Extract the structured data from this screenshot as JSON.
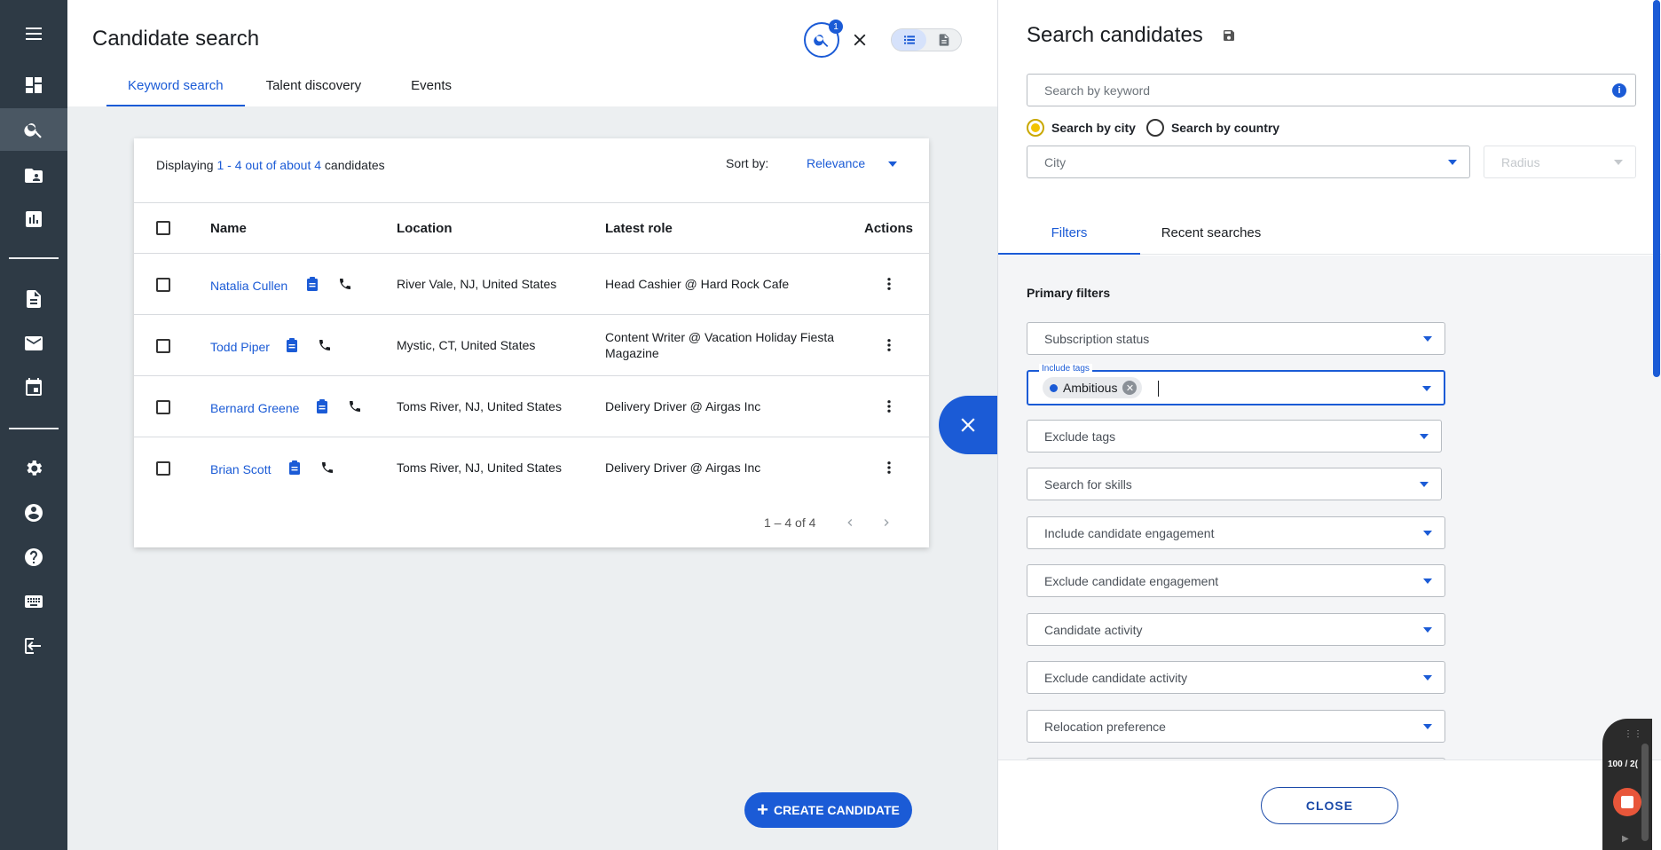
{
  "sidebar": {
    "items": [
      {
        "icon": "menu-icon"
      },
      {
        "icon": "dashboard-icon"
      },
      {
        "icon": "search-icon",
        "active": true
      },
      {
        "icon": "contacts-icon"
      },
      {
        "icon": "analytics-icon"
      },
      {
        "icon": "document-icon"
      },
      {
        "icon": "mail-icon"
      },
      {
        "icon": "calendar-icon"
      },
      {
        "icon": "settings-icon"
      },
      {
        "icon": "account-icon"
      },
      {
        "icon": "help-icon"
      },
      {
        "icon": "keyboard-icon"
      },
      {
        "icon": "logout-icon"
      }
    ]
  },
  "header": {
    "title": "Candidate search",
    "search_badge": "1",
    "tabs": [
      {
        "label": "Keyword search",
        "active": true
      },
      {
        "label": "Talent discovery"
      },
      {
        "label": "Events"
      }
    ]
  },
  "results": {
    "display_prefix": "Displaying",
    "display_range": "1 - 4 out of about 4",
    "display_suffix": "candidates",
    "sort_label": "Sort by:",
    "sort_value": "Relevance",
    "columns": [
      "Name",
      "Location",
      "Latest role",
      "Actions"
    ],
    "rows": [
      {
        "name": "Natalia Cullen",
        "location": "River Vale, NJ, United States",
        "role": "Head Cashier @ Hard Rock Cafe"
      },
      {
        "name": "Todd Piper",
        "location": "Mystic, CT, United States",
        "role": "Content Writer @ Vacation Holiday Fiesta Magazine"
      },
      {
        "name": "Bernard Greene",
        "location": "Toms River, NJ, United States",
        "role": "Delivery Driver @ Airgas Inc"
      },
      {
        "name": "Brian Scott",
        "location": "Toms River, NJ, United States",
        "role": "Delivery Driver @ Airgas Inc"
      }
    ],
    "pager": "1 – 4 of 4"
  },
  "create_button": "CREATE CANDIDATE",
  "panel": {
    "title": "Search candidates",
    "keyword_placeholder": "Search by keyword",
    "radio_city": "Search by city",
    "radio_country": "Search by country",
    "city_placeholder": "City",
    "radius_placeholder": "Radius",
    "tabs": [
      "Filters",
      "Recent searches"
    ],
    "primary_filters_title": "Primary filters",
    "filters": [
      "Subscription status",
      "Exclude tags",
      "Search for skills",
      "Include candidate engagement",
      "Exclude candidate engagement",
      "Candidate activity",
      "Exclude candidate activity",
      "Relocation preference"
    ],
    "include_tags_label": "Include tags",
    "include_tags_chip": "Ambitious",
    "close_button": "CLOSE"
  },
  "recorder": {
    "zoom": "100 / 2("
  },
  "colors": {
    "accent": "#1b5bd6",
    "sidebar": "#2e3a45",
    "radio_selected": "#f2c300"
  }
}
